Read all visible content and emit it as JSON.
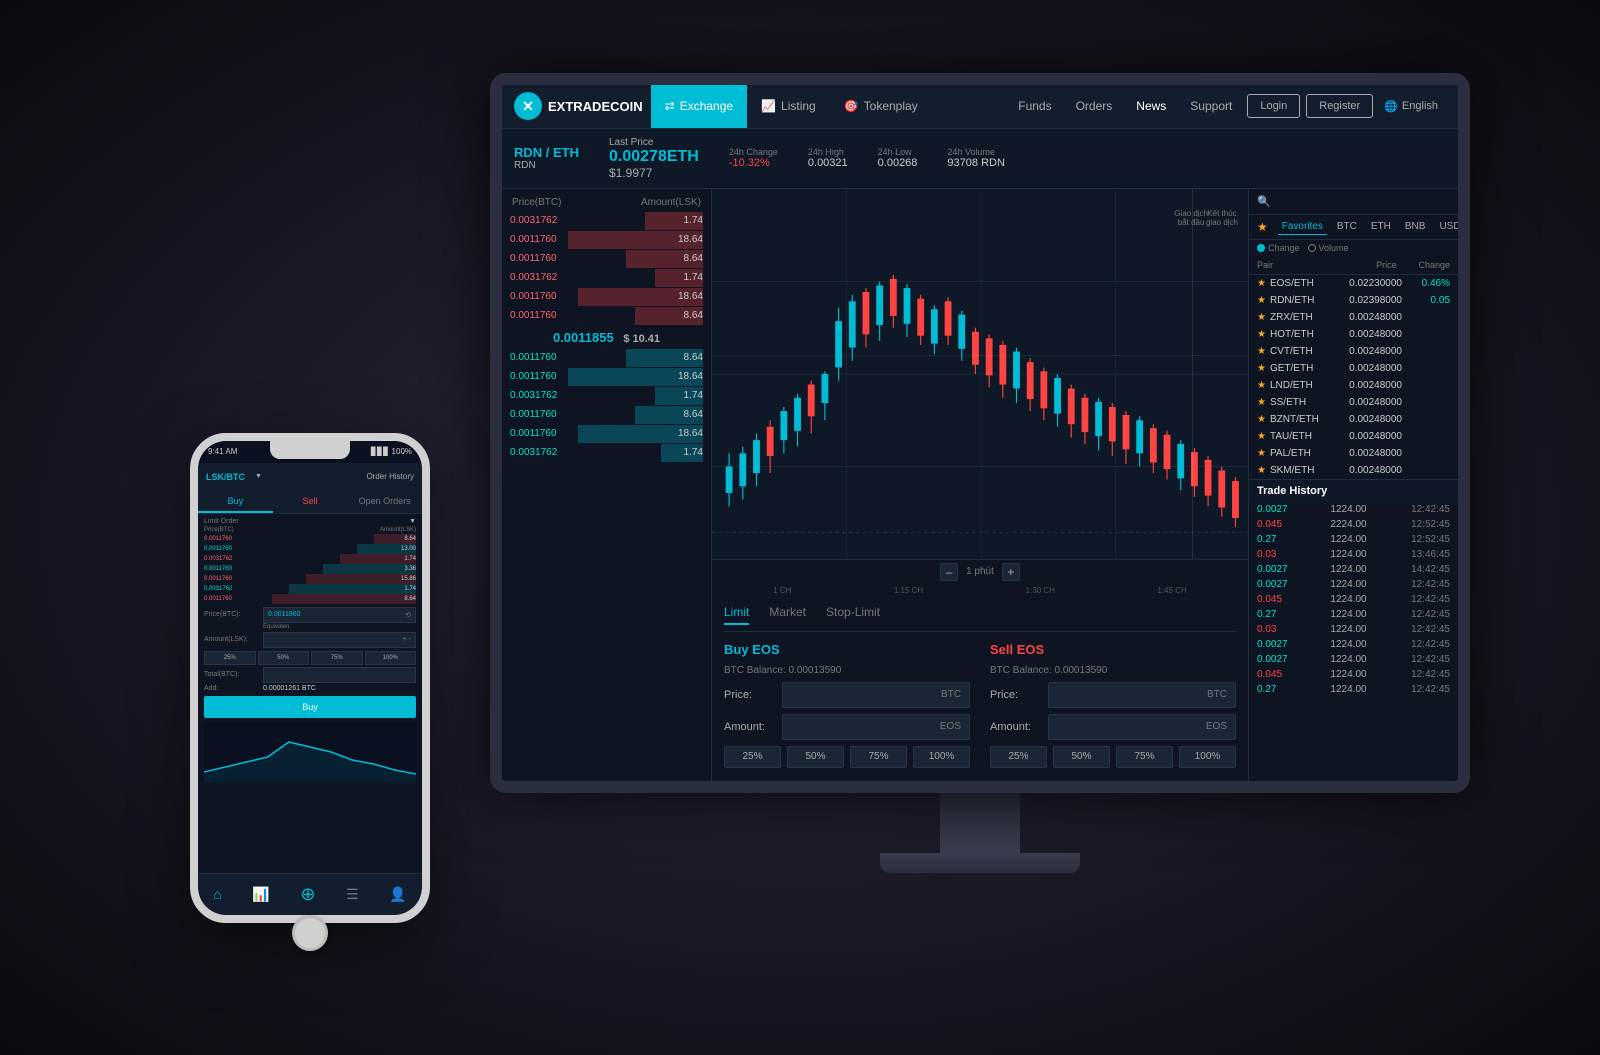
{
  "brand": {
    "name": "EXTRADECOIN",
    "logo_char": "✕"
  },
  "navbar": {
    "exchange_label": "Exchange",
    "listing_label": "Listing",
    "tokenplay_label": "Tokenplay",
    "funds_label": "Funds",
    "orders_label": "Orders",
    "news_label": "News",
    "support_label": "Support",
    "login_label": "Login",
    "register_label": "Register",
    "language_label": "English"
  },
  "ticker": {
    "pair": "RDN / ETH",
    "base": "RDN",
    "last_price_label": "Last Price",
    "last_price_eth": "0.00278ETH",
    "last_price_usd": "$1.9977",
    "change_24h_label": "24h Change",
    "change_24h": "-10.32%",
    "high_24h_label": "24h High",
    "high_24h": "0.00321",
    "low_24h_label": "24h Low",
    "low_24h": "0.00268",
    "volume_24h_label": "24h Volume",
    "volume_24h": "93708 RDN"
  },
  "orderbook": {
    "price_col": "Price(BTC)",
    "amount_col": "Amount(LSK)",
    "sell_orders": [
      {
        "price": "0.0031762",
        "amount": "1.74",
        "bar_pct": 30
      },
      {
        "price": "0.0011760",
        "amount": "18.64",
        "bar_pct": 70
      },
      {
        "price": "0.0011760",
        "amount": "8.64",
        "bar_pct": 40
      },
      {
        "price": "0.0031762",
        "amount": "1.74",
        "bar_pct": 25
      },
      {
        "price": "0.0011760",
        "amount": "18.64",
        "bar_pct": 65
      },
      {
        "price": "0.0011760",
        "amount": "8.64",
        "bar_pct": 35
      }
    ],
    "current_price": "0.0011855",
    "current_price_usd": "$ 10.41",
    "buy_orders": [
      {
        "price": "0.0011760",
        "amount": "8.64",
        "bar_pct": 40
      },
      {
        "price": "0.0011760",
        "amount": "18.64",
        "bar_pct": 70
      },
      {
        "price": "0.0031762",
        "amount": "1.74",
        "bar_pct": 25
      },
      {
        "price": "0.0011760",
        "amount": "8.64",
        "bar_pct": 35
      },
      {
        "price": "0.0011760",
        "amount": "18.64",
        "bar_pct": 65
      },
      {
        "price": "0.0031762",
        "amount": "1.74",
        "bar_pct": 22
      }
    ]
  },
  "chart": {
    "interval": "1 phút",
    "minus_label": "–",
    "plus_label": "+",
    "time_labels": [
      "1 CH",
      "1:15 CH",
      "1:30 CH",
      "1:45 CH"
    ],
    "giao_dich": "Giao dịch\nbắt đầu",
    "ket_thuc": "Kết thúc\ngiao dịch"
  },
  "trade_form": {
    "limit_tab": "Limit",
    "market_tab": "Market",
    "stop_limit_tab": "Stop-Limit",
    "buy_title": "Buy EOS",
    "sell_title": "Sell EOS",
    "btc_balance_label": "BTC Balance: 0.00013590",
    "price_label": "Price:",
    "amount_label": "Amount:",
    "btc_unit": "BTC",
    "eos_unit": "EOS",
    "pct_25": "25%",
    "pct_50": "50%",
    "pct_75": "75%",
    "pct_100": "100%"
  },
  "right_panel": {
    "favorites_label": "Favorites",
    "btc_tab": "BTC",
    "eth_tab": "ETH",
    "bnb_tab": "BNB",
    "usdt_tab": "USDT",
    "change_label": "Change",
    "volume_label": "Volume",
    "pair_col": "Pair",
    "price_col": "Price",
    "change_col": "Change",
    "pairs": [
      {
        "name": "EOS/ETH",
        "price": "0.02230000",
        "change": "0.46%",
        "pos": true
      },
      {
        "name": "RDN/ETH",
        "price": "0.02398000",
        "change": "0.05",
        "pos": true
      },
      {
        "name": "ZRX/ETH",
        "price": "0.00248000",
        "change": "",
        "pos": false
      },
      {
        "name": "HOT/ETH",
        "price": "0.00248000",
        "change": "",
        "pos": false
      },
      {
        "name": "CVT/ETH",
        "price": "0.00248000",
        "change": "",
        "pos": false
      },
      {
        "name": "GET/ETH",
        "price": "0.00248000",
        "change": "",
        "pos": false
      },
      {
        "name": "LND/ETH",
        "price": "0.00248000",
        "change": "",
        "pos": false
      },
      {
        "name": "SS/ETH",
        "price": "0.00248000",
        "change": "",
        "pos": false
      },
      {
        "name": "BZNT/ETH",
        "price": "0.00248000",
        "change": "",
        "pos": false
      },
      {
        "name": "TAU/ETH",
        "price": "0.00248000",
        "change": "",
        "pos": false
      },
      {
        "name": "PAL/ETH",
        "price": "0.00248000",
        "change": "",
        "pos": false
      },
      {
        "name": "SKM/ETH",
        "price": "0.00248000",
        "change": "",
        "pos": false
      }
    ],
    "trade_history_label": "Trade History",
    "history": [
      {
        "price": "0.0027",
        "price_type": "buy",
        "amount": "1224.00",
        "time": "12:42:45"
      },
      {
        "price": "0.045",
        "price_type": "sell",
        "amount": "2224.00",
        "time": "12:52:45"
      },
      {
        "price": "0.27",
        "price_type": "buy",
        "amount": "1224.00",
        "time": "12:52:45"
      },
      {
        "price": "0.03",
        "price_type": "sell",
        "amount": "1224.00",
        "time": "13:46:45"
      },
      {
        "price": "0.0027",
        "price_type": "buy",
        "amount": "1224.00",
        "time": "14:42:45"
      },
      {
        "price": "0.0027",
        "price_type": "buy",
        "amount": "1224.00",
        "time": "12:42:45"
      },
      {
        "price": "0.045",
        "price_type": "sell",
        "amount": "1224.00",
        "time": "12:42:45"
      },
      {
        "price": "0.27",
        "price_type": "buy",
        "amount": "1224.00",
        "time": "12:42:45"
      },
      {
        "price": "0.03",
        "price_type": "sell",
        "amount": "1224.00",
        "time": "12:42:45"
      },
      {
        "price": "0.0027",
        "price_type": "buy",
        "amount": "1224.00",
        "time": "12:42:45"
      },
      {
        "price": "0.0027",
        "price_type": "buy",
        "amount": "1224.00",
        "time": "12:42:45"
      },
      {
        "price": "0.045",
        "price_type": "sell",
        "amount": "1224.00",
        "time": "12:42:45"
      },
      {
        "price": "0.27",
        "price_type": "buy",
        "amount": "1224.00",
        "time": "12:42:45"
      }
    ]
  },
  "phone": {
    "time": "9:41 AM",
    "pair": "LSK/BTC",
    "order_history_label": "Order History",
    "buy_tab": "Buy",
    "sell_tab": "Sell",
    "open_orders_tab": "Open Orders",
    "limit_order_label": "Limit Order",
    "price_btc": "0.0011860",
    "equivalen_label": "Equivalen:",
    "amount_label": "Amount(LSK):",
    "total_btc_label": "Total(BTC):",
    "add_label": "Add:",
    "add_value": "0.00001261 BTC",
    "buy_button": "Buy",
    "bottom_nav": [
      "🏠",
      "📊",
      "💧",
      "📋",
      "👤"
    ]
  }
}
